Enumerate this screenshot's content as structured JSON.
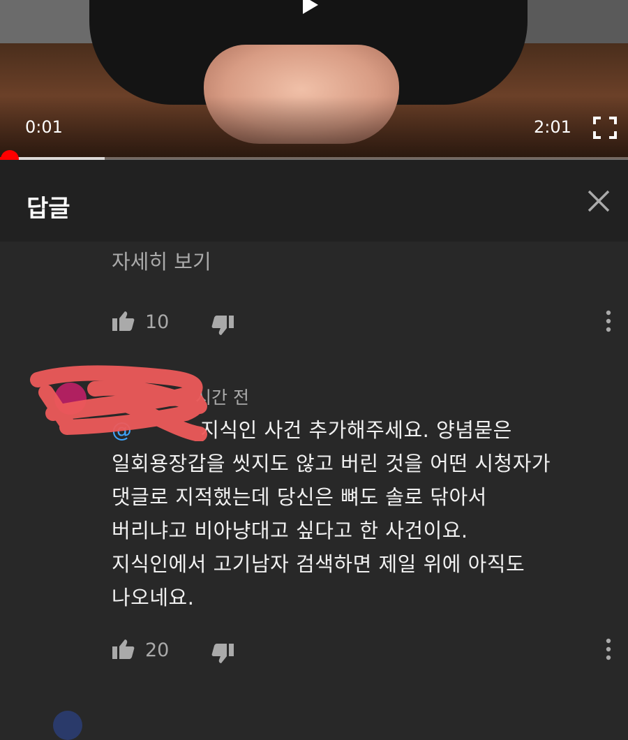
{
  "player": {
    "current_time": "0:01",
    "total_time": "2:01",
    "progress_fraction": 0.008,
    "colors": {
      "progress": "#ff0000",
      "accent_link": "#3ea6ff"
    }
  },
  "replies_panel": {
    "title": "답글",
    "read_more_label": "자세히 보기",
    "first_comment_likes": "10"
  },
  "comment": {
    "timestamp_suffix": "시간 전",
    "mention_prefix": "@",
    "text": " 지식인 사건 추가해주세요. 양념묻은\n일회용장갑을 씻지도 않고 버린 것을 어떤 시청자가\n댓글로 지적했는데 당신은 뼈도 솔로 닦아서\n버리냐고 비아냥대고 싶다고 한 사건이요.\n지식인에서 고기남자 검색하면 제일 위에 아직도\n나오네요.",
    "likes": "20"
  },
  "icons": {
    "like": "thumbs-up-icon",
    "dislike": "thumbs-down-icon",
    "more": "more-vertical-icon",
    "close": "close-icon",
    "fullscreen": "fullscreen-icon",
    "play": "play-icon"
  }
}
